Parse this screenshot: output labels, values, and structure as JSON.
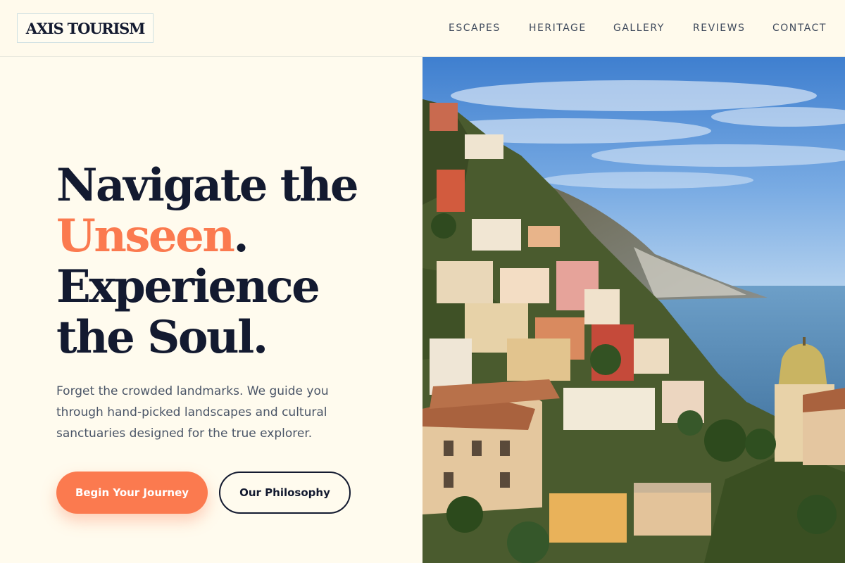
{
  "brand": {
    "name": "AXIS TOURISM"
  },
  "nav": {
    "items": [
      {
        "label": "ESCAPES"
      },
      {
        "label": "HERITAGE"
      },
      {
        "label": "GALLERY"
      },
      {
        "label": "REVIEWS"
      },
      {
        "label": "CONTACT"
      }
    ]
  },
  "hero": {
    "headline": {
      "line1": "Navigate the",
      "accent": "Unseen",
      "accent_suffix": ".",
      "line3": "Experience",
      "line4": "the Soul."
    },
    "subtext": "Forget the crowded landmarks. We guide you through hand-picked landscapes and cultural sanctuaries designed for the true explorer.",
    "primary_cta": "Begin Your Journey",
    "secondary_cta": "Our Philosophy"
  },
  "colors": {
    "accent": "#fb7a4f",
    "ink": "#131a30",
    "background": "#fffbee"
  }
}
